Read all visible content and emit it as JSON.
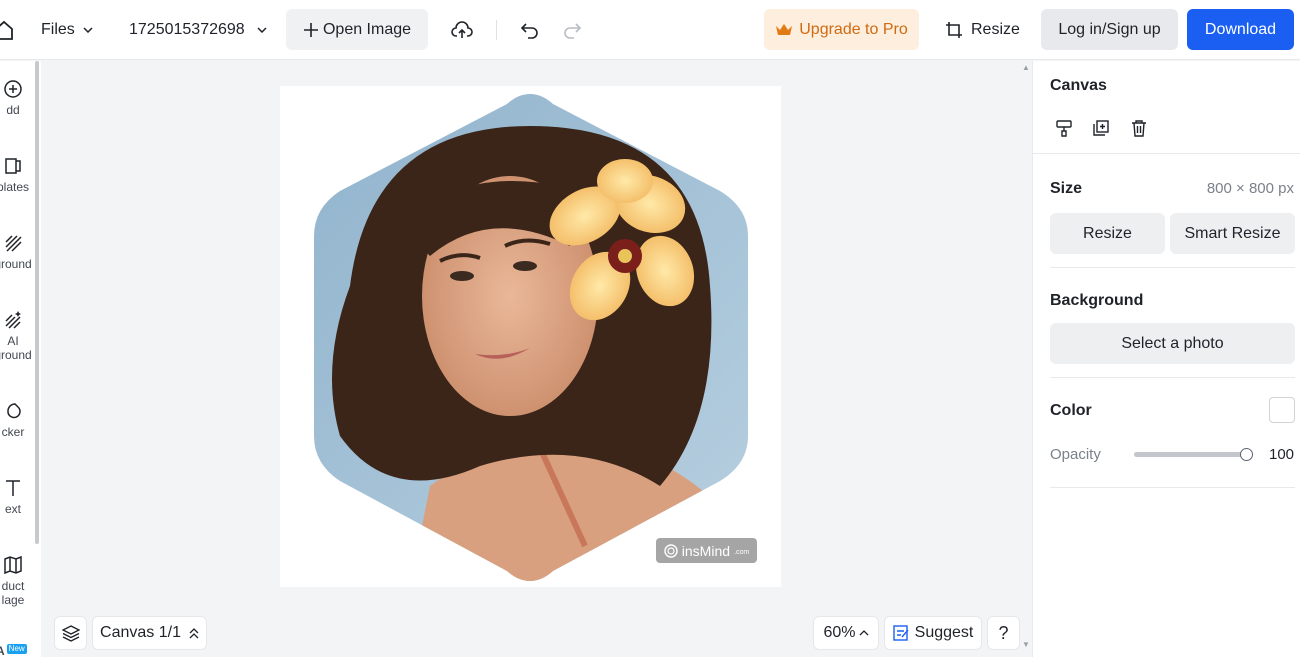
{
  "topbar": {
    "files_label": "Files",
    "file_name": "1725015372698",
    "open_image_label": "Open Image",
    "upgrade_label": "Upgrade to Pro",
    "resize_label": "Resize",
    "login_label": "Log in/Sign up",
    "download_label": "Download"
  },
  "sidebar": {
    "items": [
      {
        "label": "dd",
        "icon": "plus-circle-icon"
      },
      {
        "label": "plates",
        "icon": "templates-icon"
      },
      {
        "label": "ground",
        "icon": "background-icon"
      },
      {
        "label": "AI\nground",
        "icon": "ai-background-icon"
      },
      {
        "label": "cker",
        "icon": "sticker-icon"
      },
      {
        "label": "ext",
        "icon": "text-icon"
      },
      {
        "label": "duct\nlage",
        "icon": "product-collage-icon"
      },
      {
        "label": "A",
        "icon": "ai-text-icon",
        "badge": "New"
      }
    ]
  },
  "canvas": {
    "watermark_text": "insMind",
    "watermark_suffix": ".com"
  },
  "bottom": {
    "canvas_pager": "Canvas 1/1",
    "zoom": "60%",
    "suggest_label": "Suggest",
    "help_label": "?"
  },
  "panel": {
    "canvas_title": "Canvas",
    "size_title": "Size",
    "size_value": "800 × 800 px",
    "resize_label": "Resize",
    "smart_resize_label": "Smart Resize",
    "background_title": "Background",
    "select_photo_label": "Select a photo",
    "color_title": "Color",
    "opacity_label": "Opacity",
    "opacity_value": "100",
    "opacity_fraction": 1.0
  },
  "colors": {
    "accent": "#1a5ff2",
    "upgrade_bg": "#fdeedd",
    "upgrade_text": "#d06a12"
  }
}
